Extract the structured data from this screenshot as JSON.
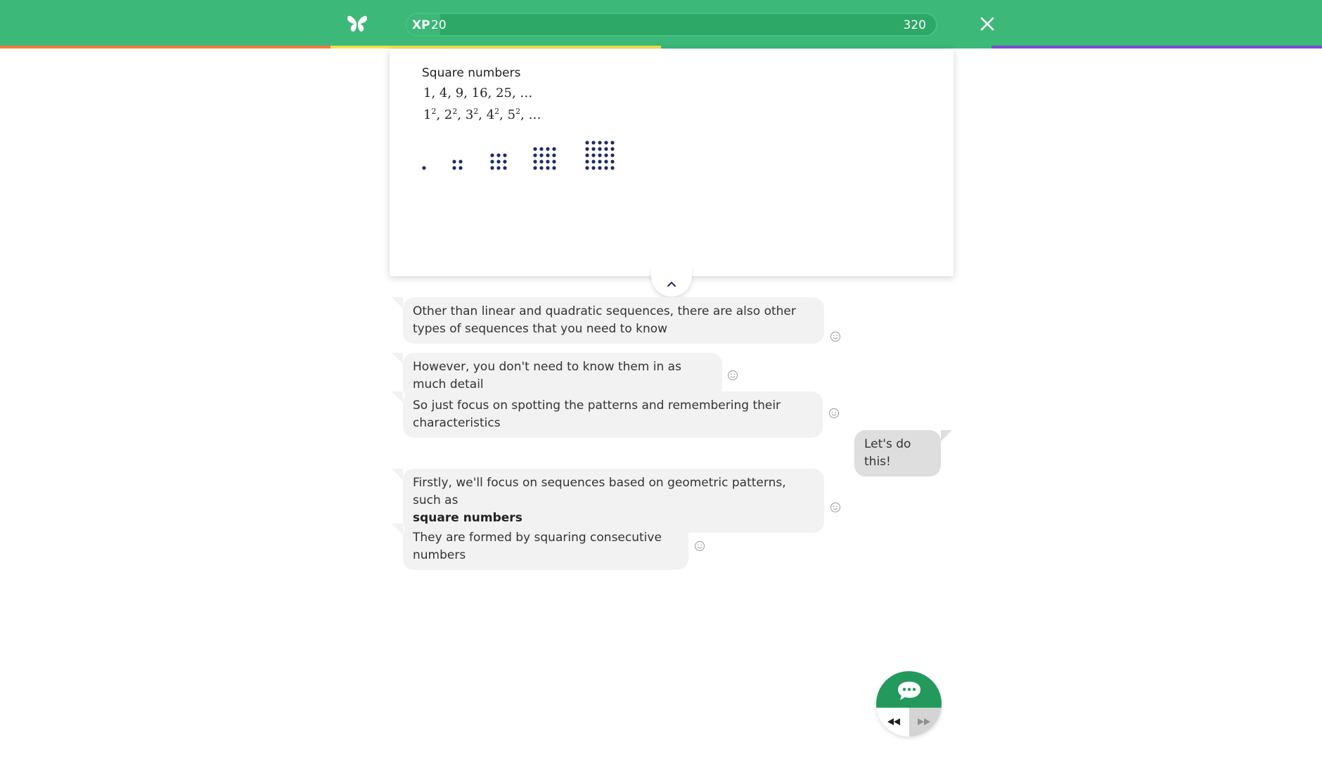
{
  "header": {
    "xp_label": "XP",
    "xp_value": "20",
    "xp_max": "320",
    "xp_progress": 0.0625,
    "logo_icon": "butterfly-icon",
    "close_icon": "close-icon",
    "stripe_colors": [
      "#f47a3c",
      "#f5e049",
      "#3cb878",
      "#7a4bd1"
    ]
  },
  "card": {
    "title": "Square numbers",
    "seq_prefix": "1, 4, 9, 16, 25, …",
    "powers": [
      {
        "base": "1",
        "exp": "2"
      },
      {
        "base": "2",
        "exp": "2"
      },
      {
        "base": "3",
        "exp": "2"
      },
      {
        "base": "4",
        "exp": "2"
      },
      {
        "base": "5",
        "exp": "2"
      }
    ],
    "powers_tail": ", …",
    "dot_grids": [
      1,
      2,
      3,
      4,
      5
    ],
    "dot_color": "#1d2a6b",
    "collapse_icon": "chevron-up-icon"
  },
  "chat": {
    "messages": [
      {
        "from": "bot",
        "text": "Other than linear and quadratic sequences, there are also other types of sequences that you need to know"
      },
      {
        "from": "bot",
        "text": "However, you don't need to know them in as much detail"
      },
      {
        "from": "bot",
        "text": "So just focus on spotting the patterns and remembering their characteristics"
      },
      {
        "from": "user",
        "text": "Let's do this!"
      },
      {
        "from": "bot",
        "text": "Firstly, we'll focus on sequences based on geometric patterns, such as",
        "bold": "square numbers"
      },
      {
        "from": "bot",
        "text": "They are formed by squaring consecutive numbers"
      }
    ],
    "reaction_icon": "smiley-icon"
  },
  "controls": {
    "chat_icon": "chat-bubble-icon",
    "rewind_icon": "rewind-icon",
    "fast_forward_icon": "fast-forward-icon"
  }
}
